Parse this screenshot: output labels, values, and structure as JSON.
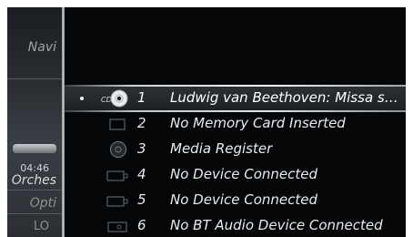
{
  "side_panel": {
    "navi_label": "Navi",
    "time": "04:46",
    "track_text": "Orches",
    "options_label": "Opti",
    "lo_label": "LO"
  },
  "media_sources": [
    {
      "number": "1",
      "label": "Ludwig van Beethoven: Missa s…",
      "icon": "cd-icon",
      "selected": true,
      "icon_text": "CD"
    },
    {
      "number": "2",
      "label": "No Memory Card Inserted",
      "icon": "memory-card-icon",
      "selected": false
    },
    {
      "number": "3",
      "label": "Media Register",
      "icon": "media-register-icon",
      "selected": false
    },
    {
      "number": "4",
      "label": "No Device Connected",
      "icon": "usb-device-icon",
      "selected": false
    },
    {
      "number": "5",
      "label": "No Device Connected",
      "icon": "usb-device-icon",
      "selected": false
    },
    {
      "number": "6",
      "label": "No BT Audio Device Connected",
      "icon": "bluetooth-audio-icon",
      "selected": false
    }
  ],
  "colors": {
    "screen_background": "#050607",
    "text": "#e8ebee",
    "selection_border": "#e2e5e7"
  }
}
